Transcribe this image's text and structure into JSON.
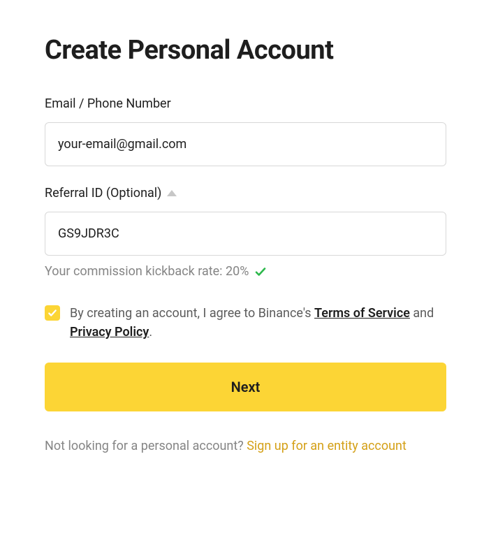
{
  "title": "Create Personal Account",
  "emailField": {
    "label": "Email / Phone Number",
    "value": "your-email@gmail.com"
  },
  "referralField": {
    "label": "Referral ID (Optional)",
    "value": "GS9JDR3C",
    "kickbackText": "Your commission kickback rate: 20%"
  },
  "agreement": {
    "checked": true,
    "prefix": "By creating an account, I agree to Binance's ",
    "termsLabel": "Terms of Service",
    "middle": " and ",
    "privacyLabel": "Privacy Policy",
    "suffix": "."
  },
  "nextButton": "Next",
  "footer": {
    "prefix": "Not looking for a personal account? ",
    "linkLabel": "Sign up for an entity account"
  }
}
